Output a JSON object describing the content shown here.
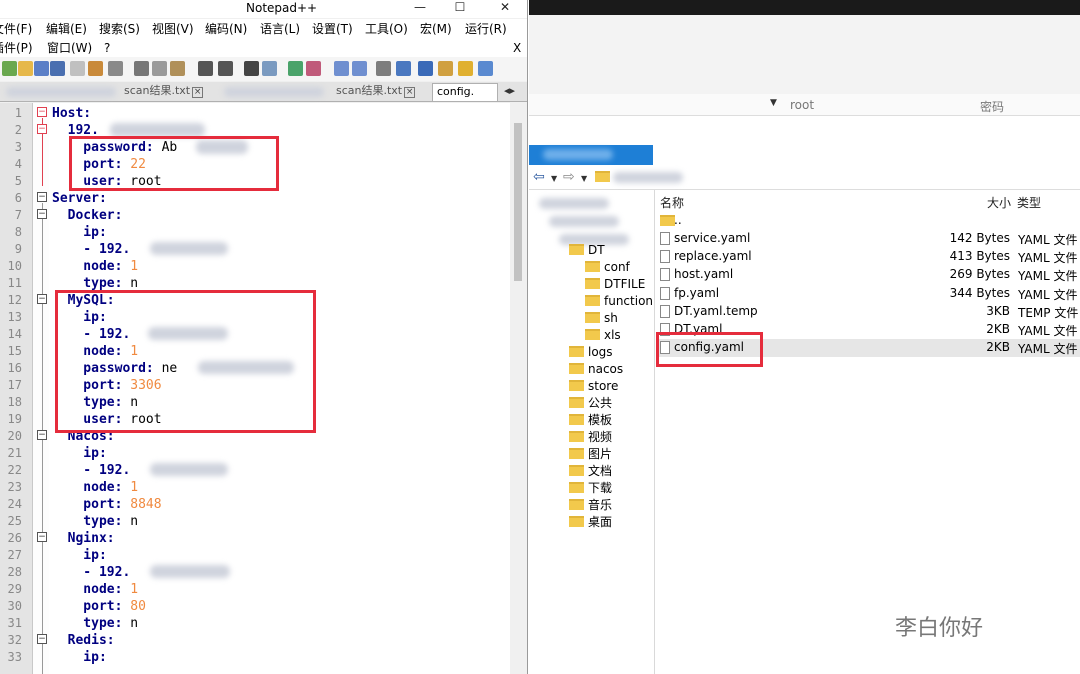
{
  "npp": {
    "title": "Notepad++",
    "menu_row1": [
      "文件(F)",
      "编辑(E)",
      "搜索(S)",
      "视图(V)",
      "编码(N)",
      "语言(L)",
      "设置(T)",
      "工具(O)",
      "宏(M)",
      "运行(R)"
    ],
    "menu_row2": [
      "插件(P)",
      "窗口(W)",
      "?"
    ],
    "close_x": "X",
    "tabs": [
      "scan结果.txt",
      "scan结果.txt",
      "config."
    ],
    "line_numbers": [
      "1",
      "2",
      "3",
      "4",
      "5",
      "6",
      "7",
      "8",
      "9",
      "10",
      "11",
      "12",
      "13",
      "14",
      "15",
      "16",
      "17",
      "18",
      "19",
      "20",
      "21",
      "22",
      "23",
      "24",
      "25",
      "26",
      "27",
      "28",
      "29",
      "30",
      "31",
      "32",
      "33"
    ],
    "lines": [
      {
        "key": "Host:",
        "val": ""
      },
      {
        "key": "  192.",
        "val": ""
      },
      {
        "key": "    password:",
        "val": " Ab"
      },
      {
        "key": "    port:",
        "val": " 22"
      },
      {
        "key": "    user:",
        "val": " root"
      },
      {
        "key": "Server:",
        "val": ""
      },
      {
        "key": "  Docker:",
        "val": ""
      },
      {
        "key": "    ip:",
        "val": ""
      },
      {
        "key": "    - 192.",
        "val": ""
      },
      {
        "key": "    node:",
        "val": " 1"
      },
      {
        "key": "    type:",
        "val": " n"
      },
      {
        "key": "  MySQL:",
        "val": ""
      },
      {
        "key": "    ip:",
        "val": ""
      },
      {
        "key": "    - 192.",
        "val": ""
      },
      {
        "key": "    node:",
        "val": " 1"
      },
      {
        "key": "    password:",
        "val": " ne"
      },
      {
        "key": "    port:",
        "val": " 3306"
      },
      {
        "key": "    type:",
        "val": " n"
      },
      {
        "key": "    user:",
        "val": " root"
      },
      {
        "key": "  Nacos:",
        "val": ""
      },
      {
        "key": "    ip:",
        "val": ""
      },
      {
        "key": "    - 192.",
        "val": ""
      },
      {
        "key": "    node:",
        "val": " 1"
      },
      {
        "key": "    port:",
        "val": " 8848"
      },
      {
        "key": "    type:",
        "val": " n"
      },
      {
        "key": "  Nginx:",
        "val": ""
      },
      {
        "key": "    ip:",
        "val": ""
      },
      {
        "key": "    - 192.",
        "val": ""
      },
      {
        "key": "    node:",
        "val": " 1"
      },
      {
        "key": "    port:",
        "val": " 80"
      },
      {
        "key": "    type:",
        "val": " n"
      },
      {
        "key": "  Redis:",
        "val": ""
      },
      {
        "key": "    ip:",
        "val": ""
      }
    ]
  },
  "connection": {
    "user": "root",
    "password_label": "密码"
  },
  "tree": [
    "DT",
    "conf",
    "DTFILE",
    "function",
    "sh",
    "xls",
    "logs",
    "nacos",
    "store",
    "公共",
    "模板",
    "视频",
    "图片",
    "文档",
    "下载",
    "音乐",
    "桌面"
  ],
  "list": {
    "headers": {
      "name": "名称",
      "size": "大小",
      "type": "类型"
    },
    "parent": "..",
    "files": [
      {
        "name": "service.yaml",
        "size": "142 Bytes",
        "type": "YAML 文件"
      },
      {
        "name": "replace.yaml",
        "size": "413 Bytes",
        "type": "YAML 文件"
      },
      {
        "name": "host.yaml",
        "size": "269 Bytes",
        "type": "YAML 文件"
      },
      {
        "name": "fp.yaml",
        "size": "344 Bytes",
        "type": "YAML 文件"
      },
      {
        "name": "DT.yaml.temp",
        "size": "3KB",
        "type": "TEMP 文件"
      },
      {
        "name": "DT.yaml",
        "size": "2KB",
        "type": "YAML 文件"
      },
      {
        "name": "config.yaml",
        "size": "2KB",
        "type": "YAML 文件"
      }
    ]
  },
  "watermark": "李白你好",
  "colors": {
    "highlight_box": "#e52c3c",
    "keyword": "#000080",
    "number": "#f08a40"
  }
}
